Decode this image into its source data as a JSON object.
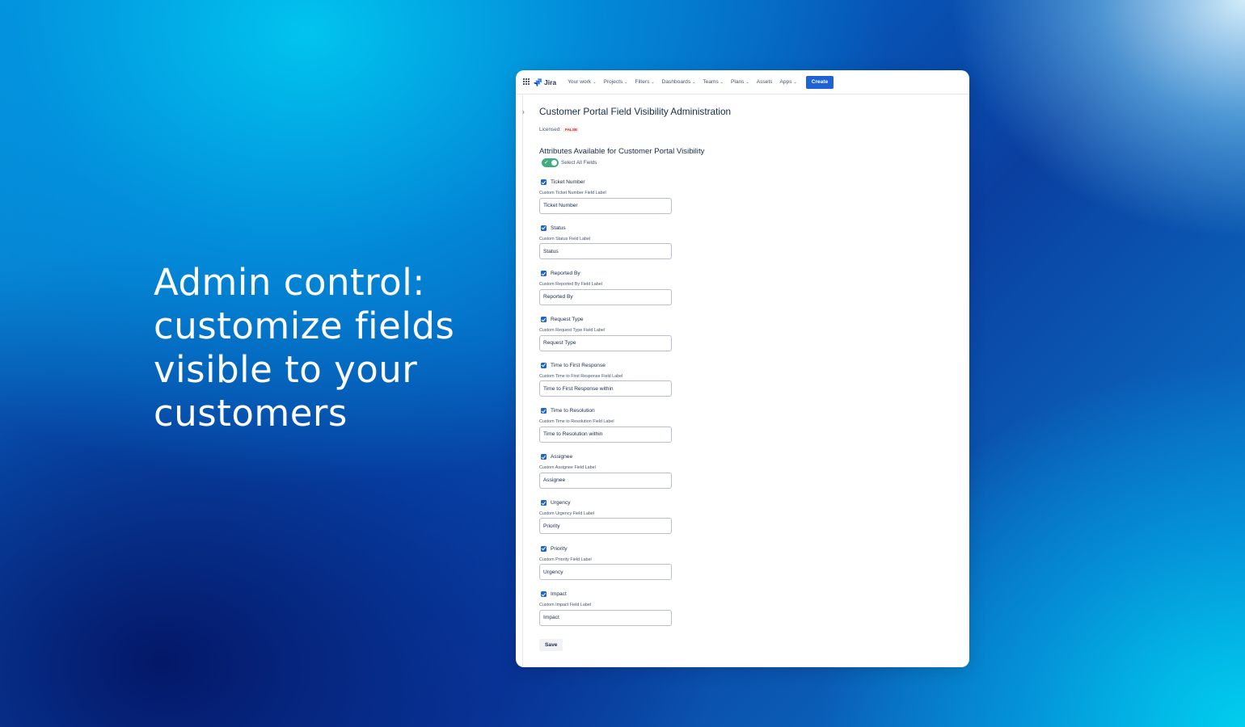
{
  "marketing": {
    "headline": "Admin control: customize fields visible to your customers"
  },
  "colors": {
    "accent": "#1d63d6",
    "toggle_on": "#22a06b",
    "lozenge_bg": "#ffecea",
    "lozenge_text": "#ae2e24"
  },
  "nav": {
    "app_switcher_icon": "grid-icon",
    "logo_text": "Jira",
    "items": [
      {
        "label": "Your work",
        "has_dropdown": true
      },
      {
        "label": "Projects",
        "has_dropdown": true
      },
      {
        "label": "Filters",
        "has_dropdown": true
      },
      {
        "label": "Dashboards",
        "has_dropdown": true
      },
      {
        "label": "Teams",
        "has_dropdown": true
      },
      {
        "label": "Plans",
        "has_dropdown": true
      },
      {
        "label": "Assets",
        "has_dropdown": false
      },
      {
        "label": "Apps",
        "has_dropdown": true
      }
    ],
    "create_label": "Create"
  },
  "page": {
    "title": "Customer Portal Field Visibility Administration",
    "licensed_label": "Licensed:",
    "licensed_value": "FALSE",
    "section_title": "Attributes Available for Customer Portal Visibility",
    "select_all_label": "Select All Fields",
    "select_all_on": true,
    "fields": [
      {
        "name": "Ticket Number",
        "checked": true,
        "label": "Custom Ticket Number Field Label",
        "value": "Ticket Number"
      },
      {
        "name": "Status",
        "checked": true,
        "label": "Custom Status Field Label",
        "value": "Status"
      },
      {
        "name": "Reported By",
        "checked": true,
        "label": "Custom Reported By Field Label",
        "value": "Reported By"
      },
      {
        "name": "Request Type",
        "checked": true,
        "label": "Custom Request Type Field Label",
        "value": "Request Type"
      },
      {
        "name": "Time to First Response",
        "checked": true,
        "label": "Custom Time to First Response Field Label",
        "value": "Time to First Response within"
      },
      {
        "name": "Time to Resolution",
        "checked": true,
        "label": "Custom Time to Resolution Field Label",
        "value": "Time to Resolution within"
      },
      {
        "name": "Assignee",
        "checked": true,
        "label": "Custom Assignee Field Label",
        "value": "Assignee"
      },
      {
        "name": "Urgency",
        "checked": true,
        "label": "Custom Urgency Field Label",
        "value": "Priority"
      },
      {
        "name": "Priority",
        "checked": true,
        "label": "Custom Priority Field Label",
        "value": "Urgency"
      },
      {
        "name": "Impact",
        "checked": true,
        "label": "Custom Impact Field Label",
        "value": "Impact"
      }
    ],
    "save_label": "Save"
  }
}
